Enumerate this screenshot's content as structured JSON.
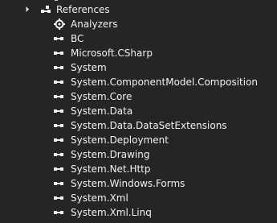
{
  "tree": {
    "references": {
      "label": "References",
      "expanded": true,
      "icon": "references-icon"
    },
    "analyzers": {
      "label": "Analyzers",
      "icon": "analyzer-icon"
    },
    "items": [
      {
        "label": "BC",
        "icon": "assembly-reference-icon"
      },
      {
        "label": "Microsoft.CSharp",
        "icon": "assembly-reference-icon"
      },
      {
        "label": "System",
        "icon": "assembly-reference-icon"
      },
      {
        "label": "System.ComponentModel.Composition",
        "icon": "assembly-reference-icon"
      },
      {
        "label": "System.Core",
        "icon": "assembly-reference-icon"
      },
      {
        "label": "System.Data",
        "icon": "assembly-reference-icon"
      },
      {
        "label": "System.Data.DataSetExtensions",
        "icon": "assembly-reference-icon"
      },
      {
        "label": "System.Deployment",
        "icon": "assembly-reference-icon"
      },
      {
        "label": "System.Drawing",
        "icon": "assembly-reference-icon"
      },
      {
        "label": "System.Net.Http",
        "icon": "assembly-reference-icon"
      },
      {
        "label": "System.Windows.Forms",
        "icon": "assembly-reference-icon"
      },
      {
        "label": "System.Xml",
        "icon": "assembly-reference-icon"
      },
      {
        "label": "System.Xml.Linq",
        "icon": "assembly-reference-icon"
      }
    ]
  },
  "colors": {
    "background": "#252526",
    "text": "#f1f1f1",
    "icon": "#f1f1f1"
  }
}
